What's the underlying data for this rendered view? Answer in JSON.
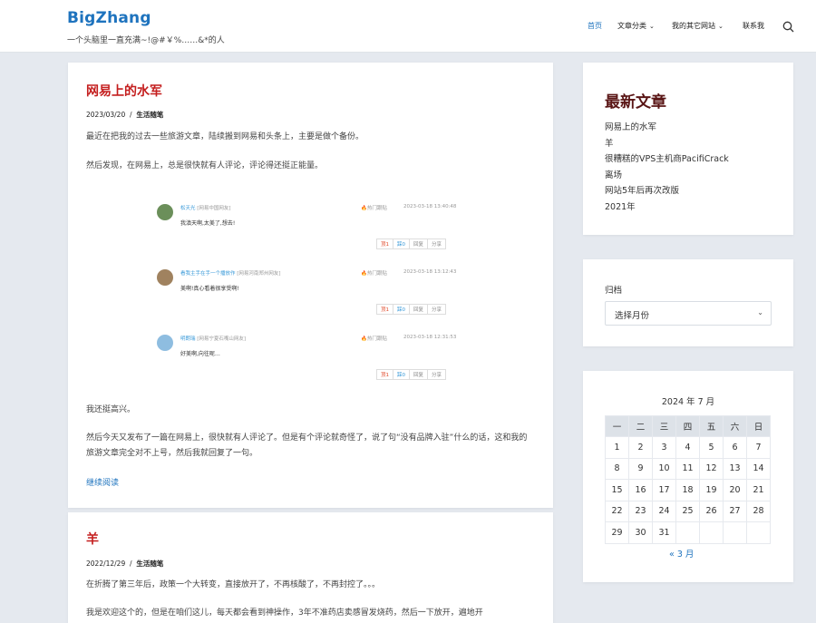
{
  "site": {
    "title": "BigZhang",
    "description": "一个头脑里一直充满~!@#￥%……&*的人"
  },
  "nav": {
    "items": [
      {
        "label": "首页",
        "active": true,
        "dropdown": false
      },
      {
        "label": "文章分类",
        "active": false,
        "dropdown": true
      },
      {
        "label": "我的其它网站",
        "active": false,
        "dropdown": true
      },
      {
        "label": "联系我",
        "active": false,
        "dropdown": false
      }
    ],
    "search_icon": "search-icon",
    "accent": "#1e73be"
  },
  "post1": {
    "title": "网易上的水军",
    "date": "2023/03/20",
    "separator": "/",
    "category": "生活随笔",
    "paragraphs": [
      "最近在把我的过去一些旅游文章，陆续搬到网易和头条上，主要是做个备份。",
      "然后发现，在网易上，总是很快就有人评论，评论得还挺正能量。",
      "我还挺高兴。",
      "然后今天又发布了一篇在网易上，很快就有人评论了。但是有个评论就奇怪了，说了句“没有品牌入驻”什么的话，这和我的旅游文章完全对不上号，然后我就回复了一句。"
    ],
    "read_more": "继续阅读",
    "comments": [
      {
        "name": "松天光",
        "location": "[网易中国网友]",
        "text": "我滇天啊,太美了,想去!",
        "hot": "热门跟贴",
        "time": "2023-03-18 13:40:48",
        "avatar_color": "#6b8f5a"
      },
      {
        "name": "看我主手在手一个播放作",
        "location": "[网易河南郑州网友]",
        "text": "美啊!真心看着很享受啊!",
        "hot": "热门跟贴",
        "time": "2023-03-18 13:12:43",
        "avatar_color": "#a0825f"
      },
      {
        "name": "明朗瑞",
        "location": "[网易宁夏石嘴山网友]",
        "text": "好美啊,向往呢…",
        "hot": "热门跟贴",
        "time": "2023-03-18 12:31:53",
        "avatar_color": "#8ebde0"
      }
    ],
    "comment_buttons": {
      "up": "顶1",
      "down": "踩0",
      "reply": "回复",
      "share": "分享"
    }
  },
  "post2": {
    "title": "羊",
    "date": "2022/12/29",
    "separator": "/",
    "category": "生活随笔",
    "paragraphs": [
      "在折腾了第三年后，政策一个大转变，直接放开了，不再核酸了，不再封控了。。。",
      "我是欢迎这个的，但是在咱们这儿，每天都会看到神操作，3年不准药店卖感冒发烧药，然后一下放开，遍地开"
    ]
  },
  "recent": {
    "title": "最新文章",
    "items": [
      "网易上的水军",
      "羊",
      "很糟糕的VPS主机商PacifiCrack",
      "离场",
      "网站5年后再次改版",
      "2021年"
    ]
  },
  "archive": {
    "label": "归档",
    "select_value": "选择月份"
  },
  "calendar": {
    "caption": "2024 年 7 月",
    "weekdays": [
      "一",
      "二",
      "三",
      "四",
      "五",
      "六",
      "日"
    ],
    "weeks": [
      [
        "1",
        "2",
        "3",
        "4",
        "5",
        "6",
        "7"
      ],
      [
        "8",
        "9",
        "10",
        "11",
        "12",
        "13",
        "14"
      ],
      [
        "15",
        "16",
        "17",
        "18",
        "19",
        "20",
        "21"
      ],
      [
        "22",
        "23",
        "24",
        "25",
        "26",
        "27",
        "28"
      ],
      [
        "29",
        "30",
        "31",
        "",
        "",
        "",
        ""
      ]
    ],
    "prev": "« 3 月"
  }
}
